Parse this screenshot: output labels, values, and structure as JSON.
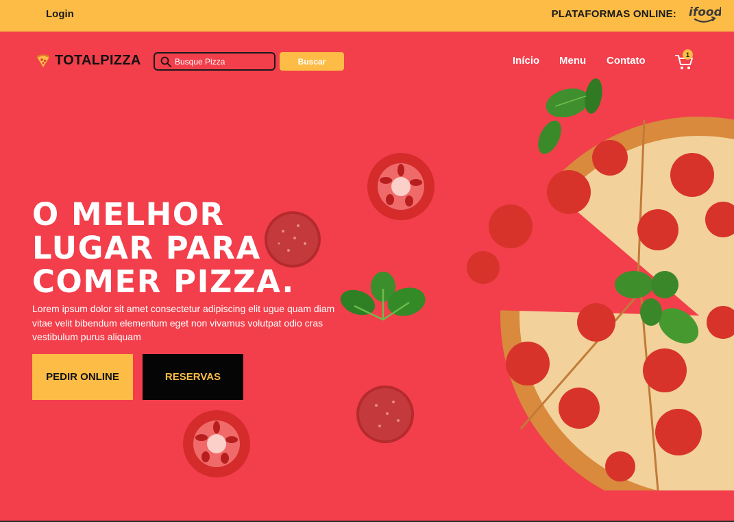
{
  "topbar": {
    "login": "Login",
    "platforms_label": "PLATAFORMAS ONLINE:",
    "ifood_logo": "ifood"
  },
  "brand": {
    "name": "TOTALPIZZA",
    "icon": "pizza-slice-icon"
  },
  "search": {
    "placeholder": "Busque Pizza",
    "value": "",
    "button": "Buscar",
    "icon": "search-icon"
  },
  "nav": {
    "items": [
      {
        "label": "Início"
      },
      {
        "label": "Menu"
      },
      {
        "label": "Contato"
      }
    ],
    "cart_icon": "cart-icon",
    "cart_count": "1"
  },
  "hero": {
    "title_lines": [
      "O MELHOR",
      "LUGAR PARA",
      "COMER PIZZA."
    ],
    "description": "Lorem ipsum dolor sit amet consectetur adipiscing elit ugue quam diam vitae velit bibendum elementum eget non vivamus volutpat odio cras vestibulum purus aliquam",
    "btn_order": "PEDIR ONLINE",
    "btn_reserve": "RESERVAS"
  },
  "colors": {
    "background": "#f23f4b",
    "accent": "#fcbc45",
    "dark": "#050505",
    "text_light": "#ffffff"
  }
}
